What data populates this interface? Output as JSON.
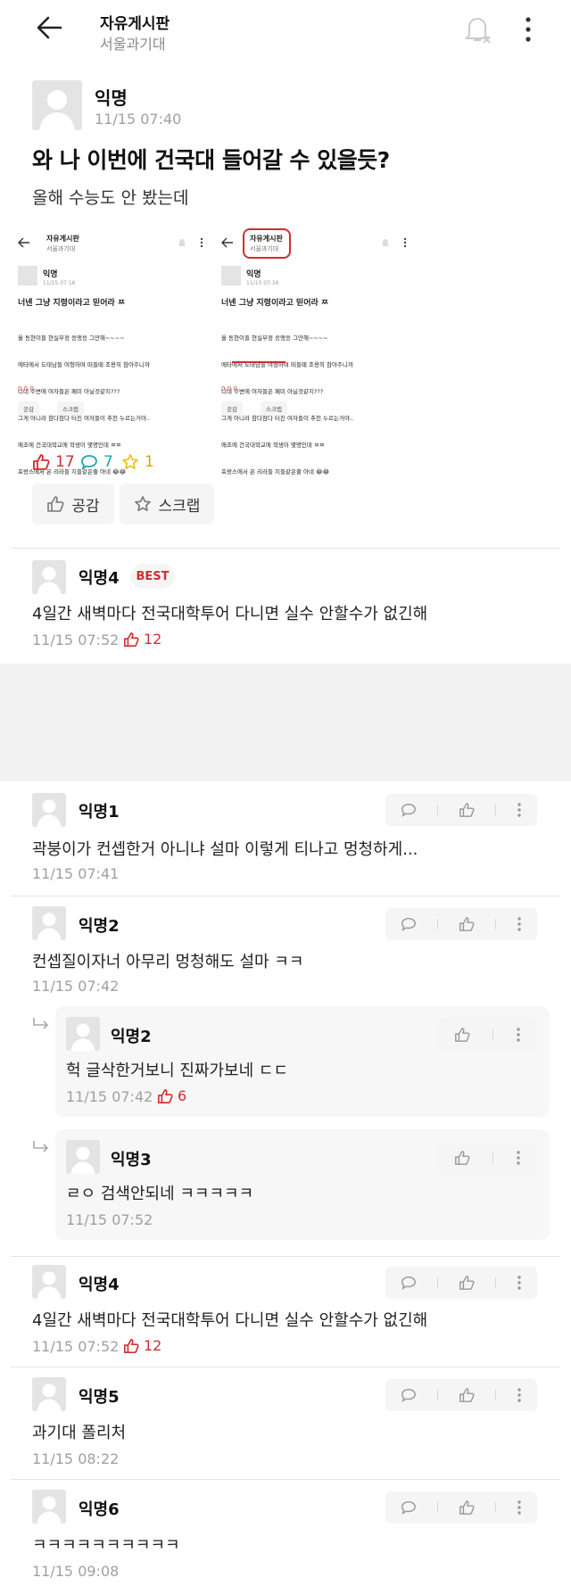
{
  "header": {
    "title": "자유게시판",
    "subtitle": "서울과기대"
  },
  "post": {
    "author": "익명",
    "time": "11/15 07:40",
    "title": "와 나 이번에 건국대 들어갈 수 있을듯?",
    "body": "올해 수능도 안 봤는데",
    "likes": "17",
    "comments": "7",
    "scraps": "1",
    "like_button": "공감",
    "scrap_button": "스크랩"
  },
  "embedded": {
    "title": "자유게시판",
    "subtitle": "서울과기대",
    "author": "익명",
    "time": "11/15 07:16",
    "heading": "너넨 그냥 지령이라고 믿어라 ㅉ",
    "body_lines": [
      "올 동현이들 현실부정 응앵응 그만해~~~~",
      "에타에서 도태남들 여형하며 떠들때 조용히 참아주니까",
      "니네 주변에 여자들은 페미 아닐것같지???",
      "그게 아니라 참다참다 터진 여자들이 추천 누르는거야..",
      "애초에 건국대학교에 학생이 몇명인데 ㅉㅉ",
      "프랑스에서 온 리라들 지들같은줄 아네 😂😂"
    ],
    "counts": "0  0  0",
    "like_button": "공감",
    "scrap_button": "스크랩"
  },
  "best_comment": {
    "author": "익명4",
    "badge": "BEST",
    "text": "4일간 새벽마다 전국대학투어 다니면 실수 안할수가 없긴해",
    "time": "11/15 07:52",
    "likes": "12"
  },
  "comments": [
    {
      "author": "익명1",
      "text": "곽붕이가 컨셉한거 아니냐 설마 이렇게 티나고 멍청하게...",
      "time": "11/15 07:41"
    },
    {
      "author": "익명2",
      "text": "컨셉질이자너 아무리 멍청해도 설마 ㅋㅋ",
      "time": "11/15 07:42"
    },
    {
      "author": "익명2",
      "text": "헉 글삭한거보니 진짜가보네 ㄷㄷ",
      "time": "11/15 07:42",
      "likes": "6"
    },
    {
      "author": "익명3",
      "text": "ㄹㅇ 검색안되네 ㅋㅋㅋㅋㅋ",
      "time": "11/15 07:52"
    },
    {
      "author": "익명4",
      "text": "4일간 새벽마다 전국대학투어 다니면 실수 안할수가 없긴해",
      "time": "11/15 07:52",
      "likes": "12"
    },
    {
      "author": "익명5",
      "text": "과기대 폴리처",
      "time": "11/15 08:22"
    },
    {
      "author": "익명6",
      "text": "ㅋㅋㅋㅋㅋㅋㅋㅋㅋㅋ",
      "time": "11/15 09:08"
    }
  ],
  "colors": {
    "accent": "#d42d2d",
    "comment": "#1aa8a8",
    "scrap": "#f0c419"
  }
}
